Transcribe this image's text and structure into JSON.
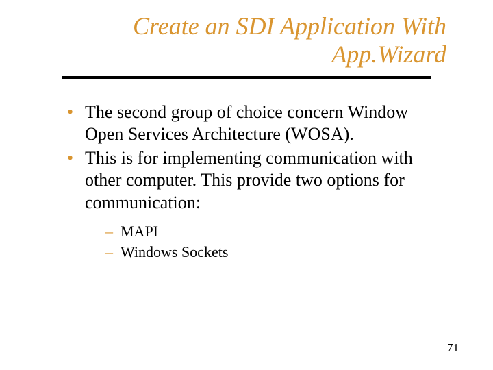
{
  "title_line1": "Create an SDI Application With",
  "title_line2": "App.Wizard",
  "bullets": [
    "The second group of choice concern Window Open Services Architecture (WOSA).",
    "This is for implementing communication with other computer.  This provide two options for communication:"
  ],
  "sub_bullets": [
    "MAPI",
    "Windows Sockets"
  ],
  "page_number": "71"
}
